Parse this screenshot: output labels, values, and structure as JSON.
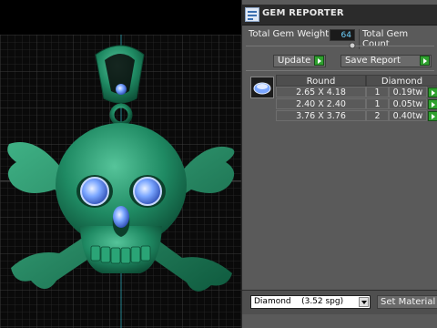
{
  "panel": {
    "title": "GEM REPORTER",
    "total_weight_label": "Total Gem Weight",
    "total_weight_value": "64",
    "total_count_label": "Total Gem Count",
    "update_label": "Update",
    "save_report_label": "Save Report",
    "gem_icon": "diamond-gem-icon",
    "table": {
      "columns": [
        "Round",
        "Diamond"
      ],
      "rows": [
        {
          "size": "2.65 X 4.18",
          "count": "1",
          "weight": "0.19tw"
        },
        {
          "size": "2.40 X 2.40",
          "count": "1",
          "weight": "0.05tw"
        },
        {
          "size": "3.76 X 3.76",
          "count": "2",
          "weight": "0.40tw"
        }
      ]
    },
    "material_select_value": "Diamond    (3.52 spg)",
    "set_material_label": "Set Material"
  },
  "viewport": {
    "model": "skull-crossbones-pendant",
    "model_color": "#1f8a63",
    "gem_color": "#7aa6ff",
    "grid_color": "#2f2f2f"
  },
  "colors": {
    "accent_green": "#2fa12f",
    "value_text": "#6fd3ff"
  }
}
